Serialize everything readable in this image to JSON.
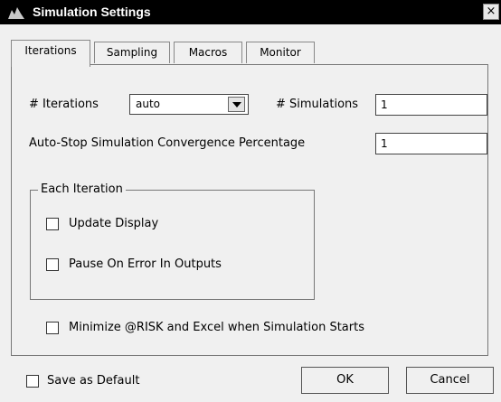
{
  "window": {
    "title": "Simulation Settings",
    "close_glyph": "×"
  },
  "tabs": [
    {
      "label": "Iterations",
      "active": true
    },
    {
      "label": "Sampling",
      "active": false
    },
    {
      "label": "Macros",
      "active": false
    },
    {
      "label": "Monitor",
      "active": false
    }
  ],
  "iterations": {
    "iterations_label": "# Iterations",
    "iterations_value": "auto",
    "simulations_label": "# Simulations",
    "simulations_value": "1",
    "convergence_label": "Auto-Stop Simulation Convergence Percentage",
    "convergence_value": "1"
  },
  "each_iteration": {
    "group_label": "Each Iteration",
    "update_display_label": "Update Display",
    "update_display_checked": false,
    "pause_on_error_label": "Pause On Error In Outputs",
    "pause_on_error_checked": false
  },
  "minimize": {
    "label": "Minimize @RISK and Excel when Simulation Starts",
    "checked": false
  },
  "footer": {
    "save_default_label": "Save as Default",
    "save_default_checked": false,
    "ok_label": "OK",
    "cancel_label": "Cancel"
  }
}
